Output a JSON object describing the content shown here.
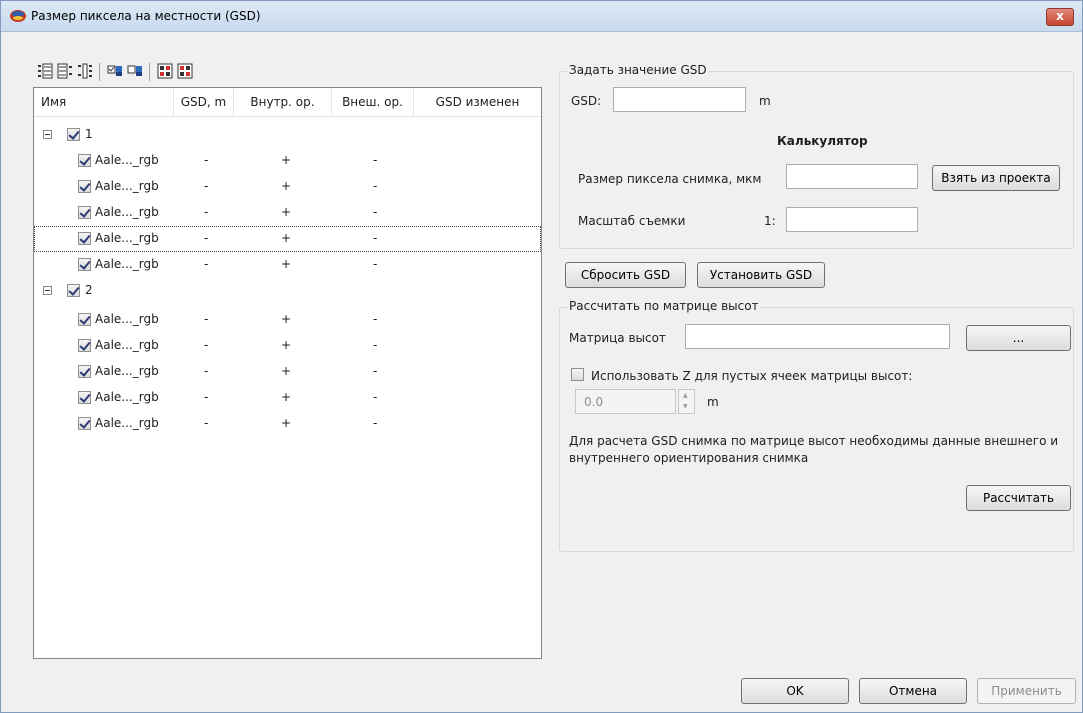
{
  "window": {
    "title": "Размер пиксела на местности (GSD)",
    "close_symbol": "x"
  },
  "toolbar": {
    "icons": [
      "expand-all-icon",
      "collapse-all-icon",
      "tree-view-icon",
      "check-all-icon",
      "uncheck-all-icon",
      "select-marked-icon",
      "deselect-marked-icon"
    ]
  },
  "tree": {
    "columns": [
      "Имя",
      "GSD, m",
      "Внутр. ор.",
      "Внеш. ор.",
      "GSD изменен"
    ],
    "groups": [
      {
        "label": "1",
        "checked": true,
        "items": [
          {
            "name": "Aale..._rgb",
            "gsd": "-",
            "inner": "+",
            "outer": "-"
          },
          {
            "name": "Aale..._rgb",
            "gsd": "-",
            "inner": "+",
            "outer": "-"
          },
          {
            "name": "Aale..._rgb",
            "gsd": "-",
            "inner": "+",
            "outer": "-"
          },
          {
            "name": "Aale..._rgb",
            "gsd": "-",
            "inner": "+",
            "outer": "-"
          },
          {
            "name": "Aale..._rgb",
            "gsd": "-",
            "inner": "+",
            "outer": "-"
          }
        ]
      },
      {
        "label": "2",
        "checked": true,
        "items": [
          {
            "name": "Aale..._rgb",
            "gsd": "-",
            "inner": "+",
            "outer": "-"
          },
          {
            "name": "Aale..._rgb",
            "gsd": "-",
            "inner": "+",
            "outer": "-"
          },
          {
            "name": "Aale..._rgb",
            "gsd": "-",
            "inner": "+",
            "outer": "-"
          },
          {
            "name": "Aale..._rgb",
            "gsd": "-",
            "inner": "+",
            "outer": "-"
          },
          {
            "name": "Aale..._rgb",
            "gsd": "-",
            "inner": "+",
            "outer": "-"
          }
        ]
      }
    ],
    "focused_row": 4
  },
  "set_gsd": {
    "group_title": "Задать значение GSD",
    "gsd_label": "GSD:",
    "gsd_value": "",
    "gsd_unit": "m",
    "calculator_title": "Калькулятор",
    "pixel_size_label": "Размер пиксела снимка, мкм",
    "pixel_size_value": "",
    "take_from_project_label": "Взять из проекта",
    "scale_label": "Масштаб съемки",
    "scale_prefix": "1:",
    "scale_value": ""
  },
  "actions": {
    "reset_label": "Сбросить GSD",
    "set_label": "Установить GSD"
  },
  "dem": {
    "group_title": "Рассчитать по матрице высот",
    "matrix_label": "Матрица высот",
    "matrix_value": "",
    "browse_label": "...",
    "use_z_label": "Использовать Z для пустых ячеек матрицы высот:",
    "use_z_checked": false,
    "z_value": "0.0",
    "z_unit": "m",
    "note": "Для расчета GSD снимка по матрице высот необходимы данные внешнего и внутреннего ориентирования снимка",
    "calculate_label": "Рассчитать"
  },
  "footer": {
    "ok_label": "OK",
    "cancel_label": "Отмена",
    "apply_label": "Применить"
  },
  "colors": {
    "title_bar": "#c9daee",
    "close_button": "#c7442e",
    "dialog_bg": "#f0f0f0"
  }
}
